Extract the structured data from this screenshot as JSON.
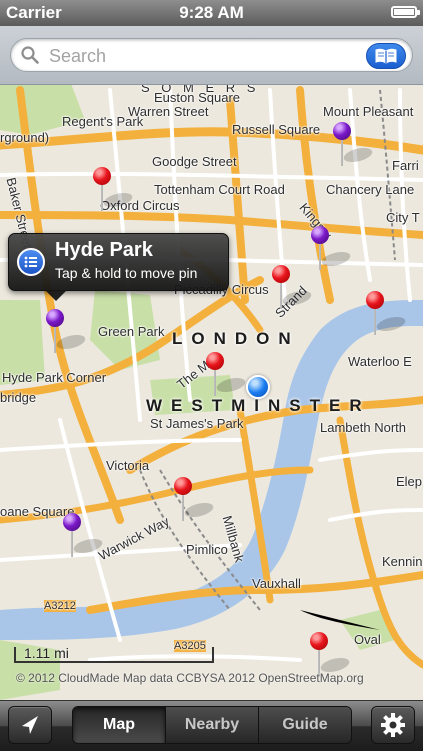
{
  "status": {
    "carrier": "Carrier",
    "time": "9:28 AM"
  },
  "search": {
    "placeholder": "Search",
    "icon": "search-icon",
    "bookmarks_icon": "bookmarks-icon"
  },
  "map": {
    "districts": [
      "LONDON",
      "WESTMINSTER"
    ],
    "labels": {
      "euston": "Euston Square",
      "warren": "Warren Street",
      "regents": "Regent's Park",
      "russell": "Russell Square",
      "mountpleasant": "Mount Pleasant",
      "goodge": "Goodge Street",
      "farring": "Farri",
      "chancery": "Chancery Lane",
      "oxford": "Oxford Circus",
      "tottenham": "Tottenham Court Road",
      "city": "City T",
      "piccadilly": "Piccadilly Circus",
      "green": "Green Park",
      "hpc": "Hyde Park Corner",
      "bridge": "bridge",
      "waterloo": "Waterloo E",
      "jamespark": "St James's Park",
      "lambeth": "Lambeth North",
      "victoria": "Victoria",
      "elep": "Elep",
      "sloane": "oane Square",
      "warwick": "Warwick Way",
      "pimlico": "Pimlico",
      "millbank": "Millbank",
      "vauxhall": "Vauxhall",
      "kenn": "Kennin",
      "oval": "Oval",
      "a3212": "A3212",
      "a3205": "A3205",
      "baker": "Baker Street",
      "strand": "Strand",
      "themall": "The Mall",
      "kingsway": "Kingsw",
      "erground": "rground)",
      "somers": "S O M E R S"
    },
    "callout": {
      "title": "Hyde Park",
      "subtitle": "Tap & hold to move pin",
      "info_icon": "list-icon"
    },
    "scale": "1.11 mi",
    "attribution": "© 2012 CloudMade  Map data CCBYSA 2012 OpenStreetMap.org"
  },
  "toolbar": {
    "locate_icon": "location-arrow-icon",
    "tabs": [
      "Map",
      "Nearby",
      "Guide"
    ],
    "selected": "Map",
    "settings_icon": "gear-icon"
  },
  "colors": {
    "pin_red": "#e8141c",
    "pin_purple": "#7b19c9",
    "current_location": "#1b7ef2",
    "river": "#a9c6e8",
    "park": "#c9dfa8",
    "main_road": "#f3b03c"
  }
}
